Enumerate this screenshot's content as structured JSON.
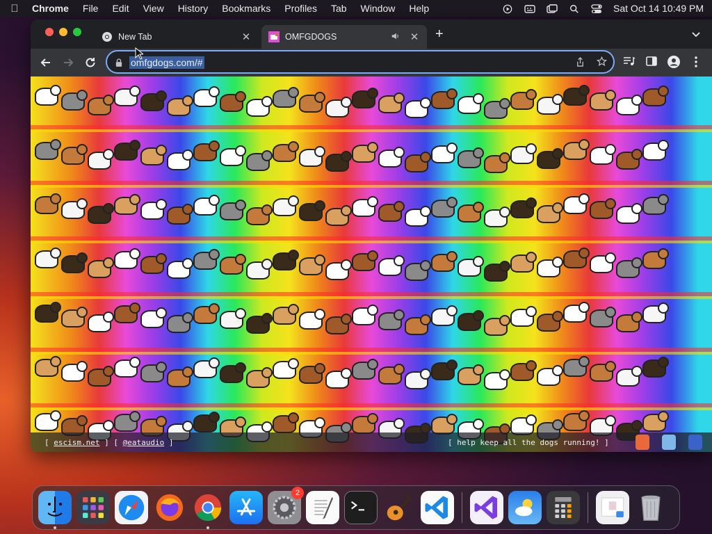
{
  "menubar": {
    "app_name": "Chrome",
    "items": [
      "File",
      "Edit",
      "View",
      "History",
      "Bookmarks",
      "Profiles",
      "Tab",
      "Window",
      "Help"
    ],
    "datetime": "Sat Oct 14  10:49 PM"
  },
  "browser": {
    "tabs": [
      {
        "title": "New Tab",
        "favicon": "chrome-icon"
      },
      {
        "title": "OMFGDOGS",
        "favicon": "omfgdogs-favicon",
        "playing_audio": true
      }
    ],
    "address_bar": {
      "url": "omfgdogs.com/#"
    }
  },
  "page": {
    "footer_left_links": [
      "escism.net",
      "@eataudio"
    ],
    "footer_right_text": "[ help keep all the dogs running! ]",
    "dog_colors": [
      "#ffffff",
      "#8a8a8a",
      "#c47a3a",
      "#f6f6f6",
      "#3a2a1a",
      "#d9a060",
      "#ffffff",
      "#a05a2a"
    ]
  },
  "dock": {
    "apps": [
      {
        "name": "Finder",
        "running": true
      },
      {
        "name": "Launchpad",
        "running": false
      },
      {
        "name": "Safari",
        "running": false
      },
      {
        "name": "Firefox",
        "running": false
      },
      {
        "name": "Google Chrome",
        "running": true
      },
      {
        "name": "App Store",
        "running": false
      },
      {
        "name": "System Settings",
        "running": false,
        "badge": "2"
      },
      {
        "name": "TextEdit",
        "running": false
      },
      {
        "name": "Terminal",
        "running": false
      },
      {
        "name": "GarageBand",
        "running": false
      },
      {
        "name": "Visual Studio Code",
        "running": false
      },
      {
        "name": "Visual Studio",
        "running": false
      },
      {
        "name": "Weather",
        "running": false
      },
      {
        "name": "Calculator",
        "running": false
      },
      {
        "name": "Preview Document",
        "running": false
      },
      {
        "name": "Trash",
        "running": false
      }
    ]
  }
}
